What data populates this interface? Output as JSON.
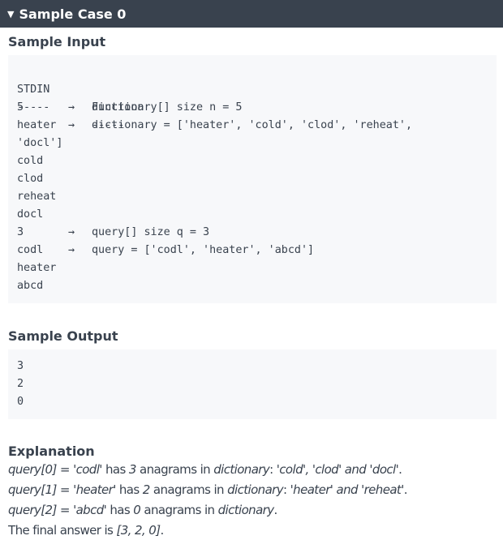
{
  "header": {
    "toggle_glyph": "▼",
    "title": "Sample Case 0"
  },
  "sample_input": {
    "title": "Sample Input",
    "col_header": {
      "left": "STDIN",
      "right": "Function"
    },
    "separator": {
      "left": "-----",
      "right": "-----"
    },
    "lines": [
      {
        "left": "5",
        "arrow": "→",
        "right": "dictionary[] size n = 5"
      },
      {
        "left": "heater",
        "arrow": "→",
        "right": "dictionary = ['heater', 'cold', 'clod', 'reheat',"
      },
      {
        "left": "'docl']",
        "arrow": "",
        "right": ""
      },
      {
        "left": "cold",
        "arrow": "",
        "right": ""
      },
      {
        "left": "clod",
        "arrow": "",
        "right": ""
      },
      {
        "left": "reheat",
        "arrow": "",
        "right": ""
      },
      {
        "left": "docl",
        "arrow": "",
        "right": ""
      },
      {
        "left": "3",
        "arrow": "→",
        "right": "query[] size q = 3"
      },
      {
        "left": "codl",
        "arrow": "→",
        "right": "query = ['codl', 'heater', 'abcd']"
      },
      {
        "left": "heater",
        "arrow": "",
        "right": ""
      },
      {
        "left": "abcd",
        "arrow": "",
        "right": ""
      }
    ]
  },
  "sample_output": {
    "title": "Sample Output",
    "lines": [
      "3",
      "2",
      "0"
    ]
  },
  "explanation": {
    "title": "Explanation",
    "lines": [
      [
        {
          "text": "query[0]",
          "italic": true
        },
        {
          "text": " = ",
          "italic": false
        },
        {
          "text": "'codl'",
          "italic": true
        },
        {
          "text": " has ",
          "italic": false
        },
        {
          "text": "3",
          "italic": true
        },
        {
          "text": " anagrams in ",
          "italic": false
        },
        {
          "text": "dictionary",
          "italic": true
        },
        {
          "text": ": ",
          "italic": false
        },
        {
          "text": "'cold', 'clod'",
          "italic": true
        },
        {
          "text": " and ",
          "italic": true
        },
        {
          "text": "'docl'",
          "italic": true
        },
        {
          "text": ".",
          "italic": false
        }
      ],
      [
        {
          "text": "query[1]",
          "italic": true
        },
        {
          "text": " = ",
          "italic": false
        },
        {
          "text": "'heater'",
          "italic": true
        },
        {
          "text": " has ",
          "italic": false
        },
        {
          "text": "2",
          "italic": true
        },
        {
          "text": " anagrams in ",
          "italic": false
        },
        {
          "text": "dictionary",
          "italic": true
        },
        {
          "text": ": ",
          "italic": false
        },
        {
          "text": "'heater' and 'reheat'",
          "italic": true
        },
        {
          "text": ".",
          "italic": false
        }
      ],
      [
        {
          "text": "query[2]",
          "italic": true
        },
        {
          "text": " = ",
          "italic": false
        },
        {
          "text": "'abcd'",
          "italic": true
        },
        {
          "text": " has ",
          "italic": false
        },
        {
          "text": "0",
          "italic": true
        },
        {
          "text": " anagrams in ",
          "italic": false
        },
        {
          "text": "dictionary",
          "italic": true
        },
        {
          "text": ".",
          "italic": false
        }
      ],
      [
        {
          "text": "The final answer is ",
          "italic": false
        },
        {
          "text": "[3, 2, 0]",
          "italic": true
        },
        {
          "text": ".",
          "italic": false
        }
      ]
    ]
  }
}
